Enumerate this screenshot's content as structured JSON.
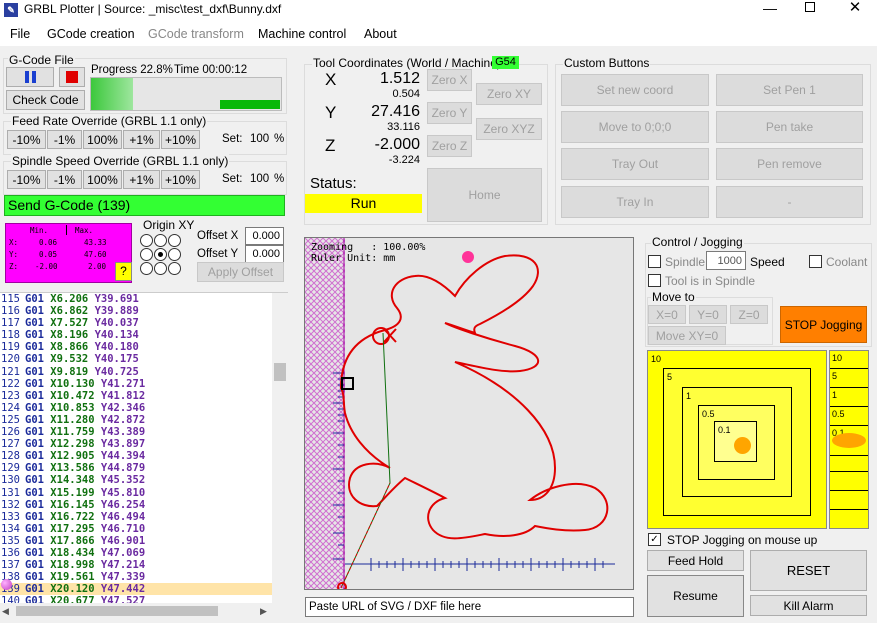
{
  "window": {
    "title": "GRBL Plotter | Source: _misc\\test_dxf\\Bunny.dxf"
  },
  "menu": [
    "File",
    "GCode creation",
    "GCode transform",
    "Machine control",
    "About"
  ],
  "gcode_file": {
    "group_label": "G-Code File",
    "check_label": "Check Code",
    "progress_label": "Progress 22.8%",
    "time_label": "Time 00:00:12",
    "progress_fraction": 0.228
  },
  "feed_override": {
    "label": "Feed Rate Override (GRBL 1.1 only)",
    "buttons": [
      "-10%",
      "-1%",
      "100%",
      "+1%",
      "+10%"
    ],
    "set_label": "Set:",
    "set_value": "100",
    "unit": "%"
  },
  "spindle_override": {
    "label": "Spindle Speed Override (GRBL 1.1 only)",
    "buttons": [
      "-10%",
      "-1%",
      "100%",
      "+1%",
      "+10%"
    ],
    "set_label": "Set:",
    "set_value": "100",
    "unit": "%"
  },
  "send_label": "Send G-Code (139)",
  "dims": {
    "h_min": "Min.",
    "h_max": "Max.",
    "rows": [
      {
        "axis": "X:",
        "min": "0.06",
        "max": "43.33"
      },
      {
        "axis": "Y:",
        "min": "0.05",
        "max": "47.60"
      },
      {
        "axis": "Z:",
        "min": "-2.00",
        "max": "2.00"
      }
    ],
    "help": "?"
  },
  "origin": {
    "label": "Origin XY",
    "offset_x_label": "Offset X",
    "offset_x": "0.000",
    "offset_y_label": "Offset Y",
    "offset_y": "0.000",
    "apply_label": "Apply Offset"
  },
  "code_lines": [
    {
      "n": "115",
      "cmd": "G01",
      "x": "X6.206",
      "y": "Y39.691"
    },
    {
      "n": "116",
      "cmd": "G01",
      "x": "X6.862",
      "y": "Y39.889"
    },
    {
      "n": "117",
      "cmd": "G01",
      "x": "X7.527",
      "y": "Y40.037"
    },
    {
      "n": "118",
      "cmd": "G01",
      "x": "X8.196",
      "y": "Y40.134"
    },
    {
      "n": "119",
      "cmd": "G01",
      "x": "X8.866",
      "y": "Y40.180"
    },
    {
      "n": "120",
      "cmd": "G01",
      "x": "X9.532",
      "y": "Y40.175"
    },
    {
      "n": "121",
      "cmd": "G01",
      "x": "X9.819",
      "y": "Y40.725"
    },
    {
      "n": "122",
      "cmd": "G01",
      "x": "X10.130",
      "y": "Y41.271"
    },
    {
      "n": "123",
      "cmd": "G01",
      "x": "X10.472",
      "y": "Y41.812"
    },
    {
      "n": "124",
      "cmd": "G01",
      "x": "X10.853",
      "y": "Y42.346"
    },
    {
      "n": "125",
      "cmd": "G01",
      "x": "X11.280",
      "y": "Y42.872"
    },
    {
      "n": "126",
      "cmd": "G01",
      "x": "X11.759",
      "y": "Y43.389"
    },
    {
      "n": "127",
      "cmd": "G01",
      "x": "X12.298",
      "y": "Y43.897"
    },
    {
      "n": "128",
      "cmd": "G01",
      "x": "X12.905",
      "y": "Y44.394"
    },
    {
      "n": "129",
      "cmd": "G01",
      "x": "X13.586",
      "y": "Y44.879"
    },
    {
      "n": "130",
      "cmd": "G01",
      "x": "X14.348",
      "y": "Y45.352"
    },
    {
      "n": "131",
      "cmd": "G01",
      "x": "X15.199",
      "y": "Y45.810"
    },
    {
      "n": "132",
      "cmd": "G01",
      "x": "X16.145",
      "y": "Y46.254"
    },
    {
      "n": "133",
      "cmd": "G01",
      "x": "X16.722",
      "y": "Y46.494"
    },
    {
      "n": "134",
      "cmd": "G01",
      "x": "X17.295",
      "y": "Y46.710"
    },
    {
      "n": "135",
      "cmd": "G01",
      "x": "X17.866",
      "y": "Y46.901"
    },
    {
      "n": "136",
      "cmd": "G01",
      "x": "X18.434",
      "y": "Y47.069"
    },
    {
      "n": "137",
      "cmd": "G01",
      "x": "X18.998",
      "y": "Y47.214"
    },
    {
      "n": "138",
      "cmd": "G01",
      "x": "X19.561",
      "y": "Y47.339"
    },
    {
      "n": "139",
      "cmd": "G01",
      "x": "X20.120",
      "y": "Y47.442"
    },
    {
      "n": "140",
      "cmd": "G01",
      "x": "X20.677",
      "y": "Y47.527"
    }
  ],
  "tool_coords": {
    "label": "Tool Coordinates (World / Machine)",
    "wcs": "G54",
    "x_axis": "X",
    "x_world": "1.512",
    "x_machine": "0.504",
    "y_axis": "Y",
    "y_world": "27.416",
    "y_machine": "33.116",
    "z_axis": "Z",
    "z_world": "-2.000",
    "z_machine": "-3.224",
    "zero_x": "Zero X",
    "zero_y": "Zero Y",
    "zero_z": "Zero Z",
    "zero_xy": "Zero XY",
    "zero_xyz": "Zero XYZ",
    "home": "Home",
    "status_label": "Status:",
    "status_value": "Run"
  },
  "custom_buttons": {
    "label": "Custom Buttons",
    "items": [
      "Set new coord",
      "Set Pen 1",
      "Move to 0;0;0",
      "Pen take",
      "Tray Out",
      "Pen remove",
      "Tray In",
      "-"
    ]
  },
  "canvas": {
    "zooming_label": "Zooming   : 100.00%",
    "ruler_label": "Ruler Unit: mm",
    "url_placeholder": "Paste URL of SVG / DXF file here"
  },
  "control": {
    "label": "Control / Jogging",
    "spindle": "Spindle",
    "spindle_speed": "1000",
    "speed_label": "Speed",
    "coolant": "Coolant",
    "tool_in_spindle": "Tool is in Spindle",
    "move_to": "Move to",
    "x0": "X=0",
    "y0": "Y=0",
    "z0": "Z=0",
    "xy0": "Move XY=0",
    "stop_jog": "STOP Jogging",
    "jog_levels": [
      "10",
      "5",
      "1",
      "0.5",
      "0.1"
    ],
    "stop_on_mouse_up": "STOP Jogging on mouse up",
    "feed_hold": "Feed Hold",
    "reset": "RESET",
    "resume": "Resume",
    "kill_alarm": "Kill Alarm"
  }
}
